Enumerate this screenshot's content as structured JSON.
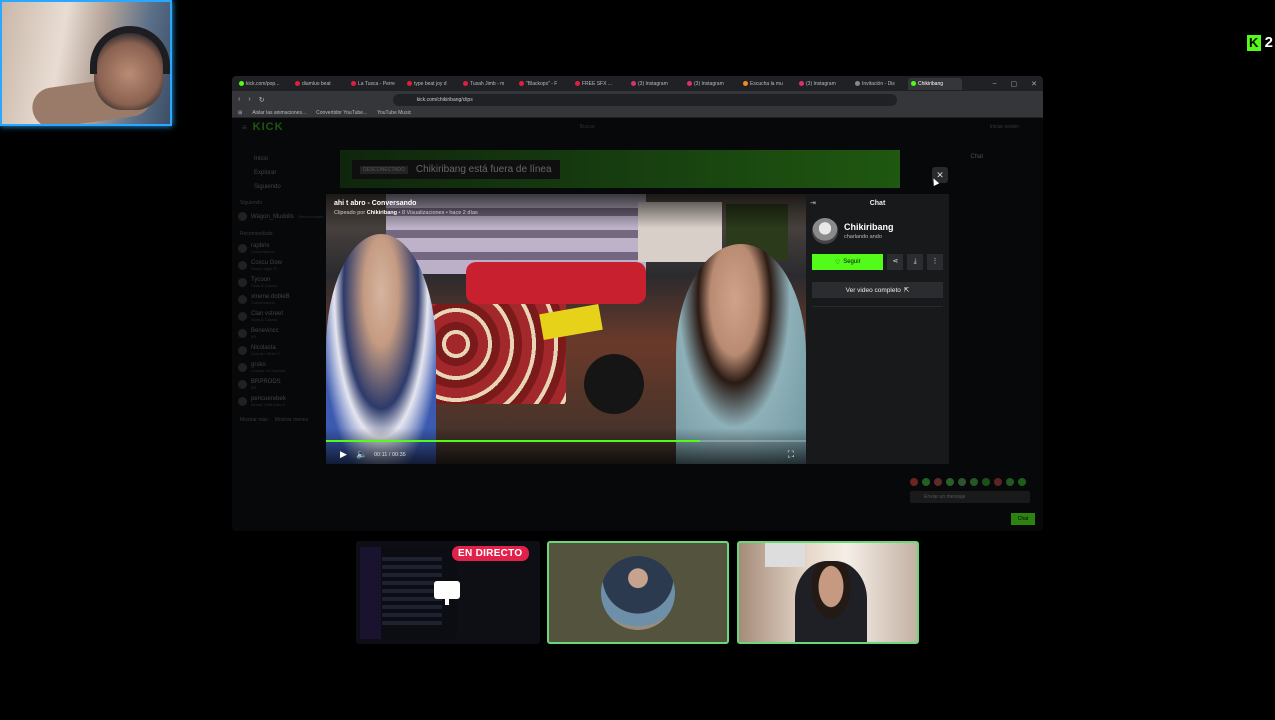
{
  "overlay": {
    "kick_badge_letter": "K",
    "kick_badge_count": "2"
  },
  "browser": {
    "tabs": [
      {
        "label": "kick.com/pop...",
        "color": "#53fc18"
      },
      {
        "label": "diamluo beat",
        "color": "#e01f3d"
      },
      {
        "label": "La Tusca - Perre",
        "color": "#e01f3d"
      },
      {
        "label": "type beat joy d",
        "color": "#e01f3d"
      },
      {
        "label": "Tusah Jimb - m",
        "color": "#e01f3d"
      },
      {
        "label": "\"Blackops\" - F",
        "color": "#e01f3d"
      },
      {
        "label": "FREE SFX ...",
        "color": "#e01f3d"
      },
      {
        "label": "(3) Instagram",
        "color": "#d6336c"
      },
      {
        "label": "(3) Instagram",
        "color": "#d6336c"
      },
      {
        "label": "Escucha la mu",
        "color": "#f08a24"
      },
      {
        "label": "(3) Instagram",
        "color": "#d6336c"
      },
      {
        "label": "Invitación - Dis",
        "color": "#888888"
      },
      {
        "label": "Chikiribang",
        "color": "#53fc18"
      }
    ],
    "active_tab_index": 12,
    "window_controls": [
      "–",
      "▢",
      "✕"
    ],
    "address": "kick.com/chikiribang/clips",
    "bookmarks": [
      "Aislar las animaciones...",
      "Convertidor YouTube...",
      "YouTube Music"
    ]
  },
  "kick": {
    "logo": "KICK",
    "search_placeholder": "Buscar",
    "login": "Iniciar sesión",
    "nav": [
      "Inicio",
      "Explorar",
      "Siguiendo"
    ],
    "following_heading": "Siguiendo",
    "following": [
      {
        "name": "Wagon_Mudolls",
        "sub": "Desconectado"
      }
    ],
    "recommended_heading": "Recomendado",
    "recommended": [
      {
        "name": "rapbrix",
        "sub": "Conversando"
      },
      {
        "name": "Coscu Gow",
        "sub": "Santa Jugar R"
      },
      {
        "name": "Tycoon",
        "sub": "Slots & Casino"
      },
      {
        "name": "xtreme.dobleB",
        "sub": "Conversando"
      },
      {
        "name": "Clan vstreet",
        "sub": "Slots & Casino"
      },
      {
        "name": "Benevincc",
        "sub": "IRL"
      },
      {
        "name": "Nicolasta",
        "sub": "Counter Strike 2"
      },
      {
        "name": "grsko",
        "sub": "League of Legends"
      },
      {
        "name": "BRPRODS",
        "sub": "IRL"
      },
      {
        "name": "pencuerebek",
        "sub": "Grand Theft Auto V"
      }
    ],
    "show_more": "Mostrar más",
    "show_less": "Mostrar menos",
    "offline_tag": "DESCONECTADO",
    "offline_text": "Chikiribang está fuera de línea",
    "chat_header": "Chat",
    "chat_input_placeholder": "Enviar un mensaje",
    "chat_send": "Chat"
  },
  "clip": {
    "close": "✕",
    "title": "ahi t abro - Conversando",
    "clipped_by_prefix": "Clipeado por",
    "clipped_by": "Chikiribang",
    "meta": "• 8 Visualizaciones • hace 2 días",
    "time": "00:11 / 00:35",
    "progress": 0.78
  },
  "panel": {
    "collapse": "⇥",
    "header": "Chat",
    "channel": "Chikiribang",
    "subtitle": "charlando ando",
    "follow": "Seguir",
    "follow_icon": "♡",
    "share": "⋖",
    "download": "⤓",
    "more": "⋮",
    "full_video": "Ver video completo",
    "full_video_icon": "⇱"
  },
  "bottom": {
    "live_label": "EN DIRECTO"
  },
  "colors": {
    "kick_green": "#53fc18",
    "live_red": "#e0224b",
    "cam_border": "#2aa7ff",
    "thumb_border": "#6cd67a"
  }
}
